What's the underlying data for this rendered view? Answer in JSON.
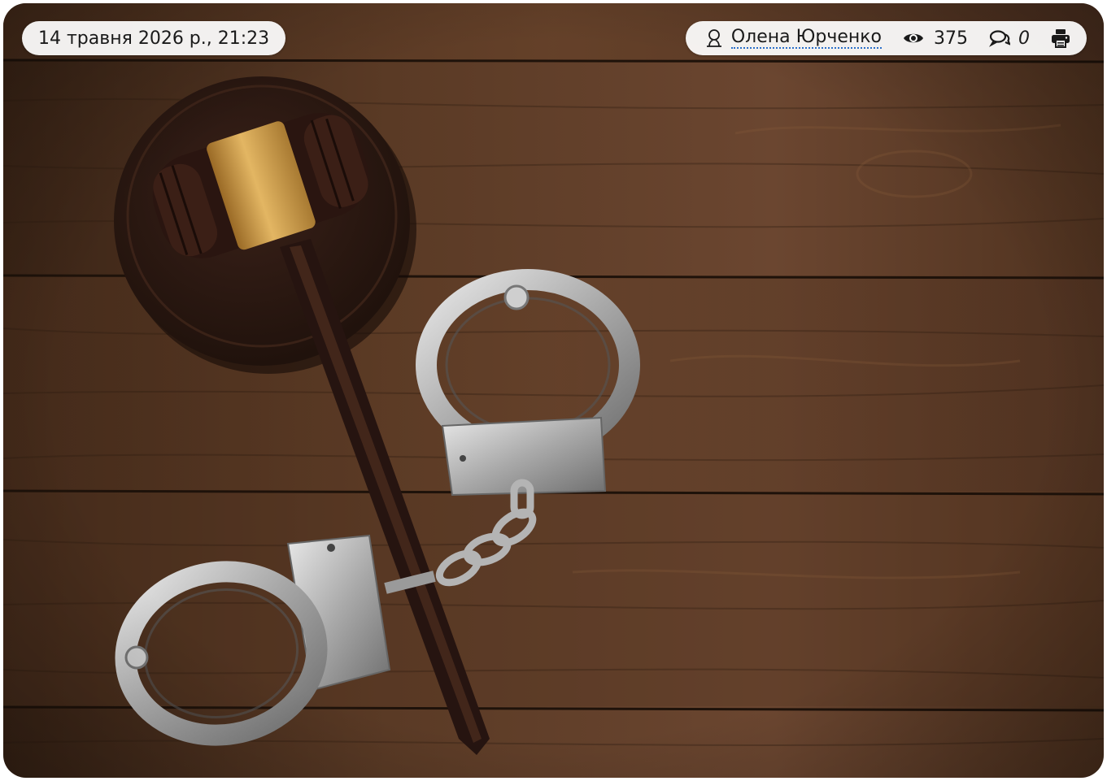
{
  "article_meta": {
    "date": "14 травня 2026 р., 21:23",
    "author": "Олена Юрченко",
    "views": "375",
    "comments": "0"
  },
  "icons": {
    "author": "user-icon",
    "views": "eye-icon",
    "comments": "comment-icon",
    "print": "printer-icon"
  },
  "colors": {
    "pill_background": "#ffffff",
    "link_underline": "#2a6fc9",
    "text": "#1a1a1a"
  },
  "image": {
    "subject": "judge gavel with gold band on sound block and steel handcuffs on a dark wooden table"
  }
}
